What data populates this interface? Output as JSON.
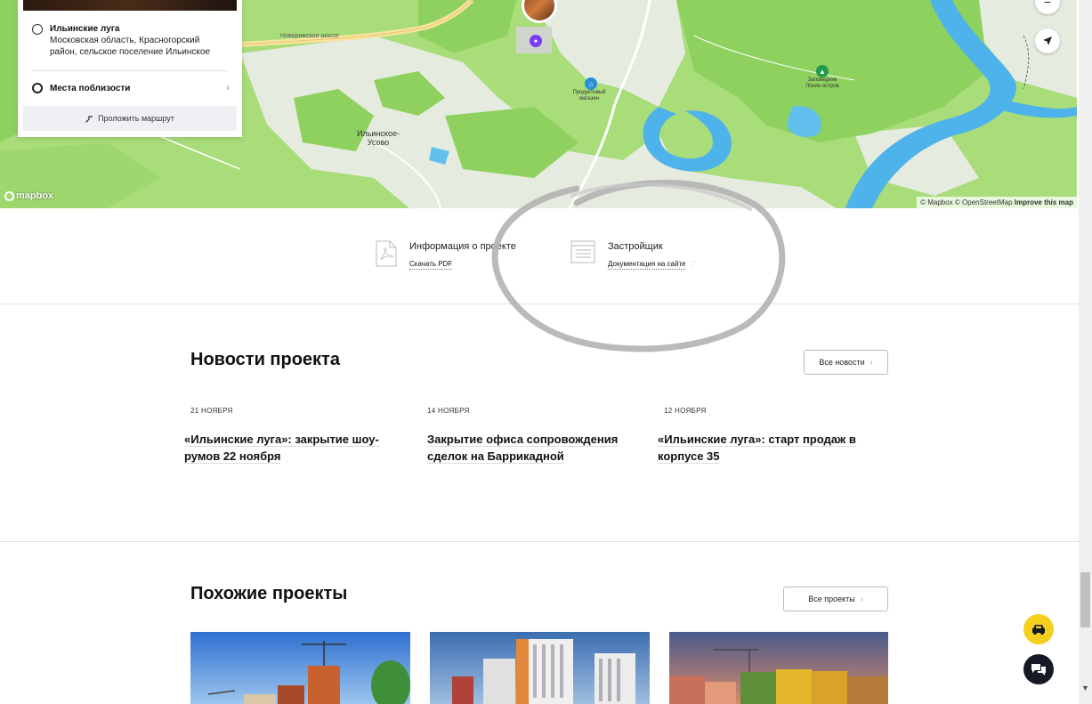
{
  "map": {
    "labels": {
      "village": "Ильинское-\nУсово",
      "shop": "Продуктовый\nмагазин",
      "reserve": "Заповедник\nЛохин остров",
      "road": "Новорижское шоссе"
    },
    "logo_text": "mapbox",
    "attribution": {
      "mapbox": "© Mapbox",
      "osm": "© OpenStreetMap",
      "improve": "Improve this map"
    },
    "zoom_out_label": "−",
    "colors": {
      "land": "#a8dd7a",
      "forest": "#8fd15f",
      "water": "#4db3ea",
      "urban": "#e8ebe3"
    }
  },
  "location_card": {
    "title": "Ильинские луга",
    "address": "Московская область, Красногорский район, сельское поселение Ильинское",
    "nearby_label": "Места поблизости",
    "route_button": "Проложить маршрут"
  },
  "docs": {
    "project_info": {
      "title": "Информация о проекте",
      "link": "Скачать PDF"
    },
    "developer": {
      "title": "Застройщик",
      "link": "Документация на сайте"
    }
  },
  "news": {
    "title": "Новости проекта",
    "all_button": "Все новости",
    "items": [
      {
        "date": "21 НОЯБРЯ",
        "title": "«Ильинские луга»: закрытие шоу-румов 22 ноября"
      },
      {
        "date": "14 НОЯБРЯ",
        "title": "Закрытие офиса сопровождения сделок на Баррикадной"
      },
      {
        "date": "12 НОЯБРЯ",
        "title": "«Ильинские луга»: старт продаж в корпусе 35"
      }
    ]
  },
  "similar": {
    "title": "Похожие проекты",
    "all_button": "Все проекты"
  },
  "colors": {
    "accent_yellow": "#f5cf1d",
    "dark": "#151a24"
  }
}
